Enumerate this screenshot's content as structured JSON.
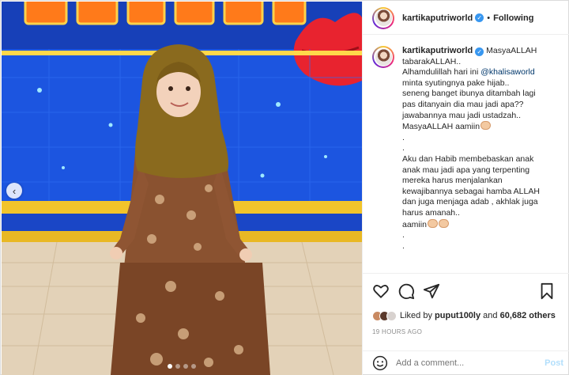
{
  "post": {
    "username": "kartikaputriworld",
    "follow_status": "Following",
    "separator": "•",
    "verified_glyph": "✓"
  },
  "media": {
    "prev_icon": "‹",
    "dot_count": 4,
    "active_dot": 1
  },
  "caption": {
    "username": "kartikaputriworld",
    "lines": [
      "MasyaALLAH",
      "tabarakALLAH..",
      "Alhamdulillah hari ini ",
      "minta syutingnya pake hijab..",
      "seneng banget ibunya ditambah lagi",
      "pas ditanyain dia mau jadi apa??",
      "jawabannya mau jadi ustadzah..",
      "MasyaALLAH aamiin",
      ".",
      ".",
      "Aku dan Habib membebaskan anak",
      "anak mau jadi apa yang terpenting",
      "mereka harus menjalankan",
      "kewajibannya sebagai hamba ALLAH",
      "dan juga menjaga adab , akhlak juga",
      "harus amanah..",
      "aamiin",
      ".",
      "."
    ],
    "mention": "@khalisaworld"
  },
  "actions": {
    "like_icon": "heart-icon",
    "comment_icon": "comment-icon",
    "share_icon": "share-icon",
    "save_icon": "bookmark-icon"
  },
  "likes": {
    "prefix": "Liked by ",
    "user": "puput100ly",
    "middle": " and ",
    "others": "60,682 others"
  },
  "timestamp": "19 HOURS AGO",
  "comment_box": {
    "placeholder": "Add a comment...",
    "post_label": "Post"
  },
  "colors": {
    "link": "#00376b",
    "verified": "#3897f0",
    "post_disabled": "#b2dffc",
    "muted": "#8e8e8e"
  }
}
